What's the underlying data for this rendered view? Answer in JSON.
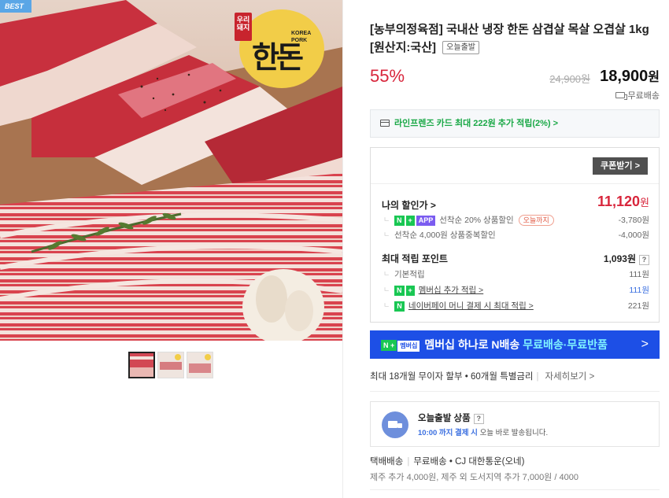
{
  "badge": {
    "best": "BEST"
  },
  "product": {
    "title": "[농부의정육점] 국내산 냉장 한돈 삼겹살 목살 오겹살 1kg [원산지:국산]",
    "today_tag": "오늘출발",
    "discount_rate": "55%",
    "original_price": "24,900원",
    "sale_price": "18,900",
    "price_unit": "원",
    "shipping": "무료배송"
  },
  "logo": {
    "label_top": "우리돼지",
    "label_en": "KOREA PORK",
    "label_main": "한돈"
  },
  "card_promo": {
    "text": "라인프렌즈 카드 최대 222원 추가 적립(2%) >"
  },
  "coupon": {
    "button": "쿠폰받기 >",
    "my_price_label": "나의 할인가 >",
    "my_price": "11,120",
    "my_price_unit": "원",
    "discounts": [
      {
        "badge1": "N",
        "badge2": "+",
        "badge3": "APP",
        "text": "선착순 20% 상품할인",
        "chip": "오늘까지",
        "value": "-3,780원"
      },
      {
        "text": "선착순 4,000원 상품중복할인",
        "value": "-4,000원"
      }
    ],
    "points_label": "최대 적립 포인트",
    "points_value": "1,093원",
    "points_q": "?",
    "points": [
      {
        "text": "기본적립",
        "value": "111원"
      },
      {
        "badge1": "N",
        "badge2": "+",
        "text": "멤버십 추가 적립 >",
        "value": "111원"
      },
      {
        "badge1": "N",
        "text": "네이버페이 머니 결제 시 최대 적립 >",
        "value": "221원"
      }
    ]
  },
  "member_banner": {
    "pill1": "N +",
    "pill2": "멤버십",
    "text": "멤버십 하나로 N배송",
    "highlight": "무료배송·무료반품",
    "arrow": ">"
  },
  "installment": {
    "text": "최대 18개월 무이자 할부 • 60개월 특별금리",
    "more": "자세히보기 >"
  },
  "today_ship": {
    "title": "오늘출발 상품",
    "q": "?",
    "time": "10:00 까지 결제 시",
    "desc": "오늘 바로 발송됩니다."
  },
  "shipping_info": {
    "method": "택배배송",
    "fee": "무료배송",
    "carrier": "• CJ 대한통운(오네)",
    "extra": "제주 추가 4,000원, 제주 외 도서지역 추가 7,000원 / 4000"
  },
  "colors": {
    "accent_red": "#d8263c",
    "green": "#19a846",
    "banner_blue": "#1d4fe6",
    "link_blue": "#3b6fe0"
  }
}
